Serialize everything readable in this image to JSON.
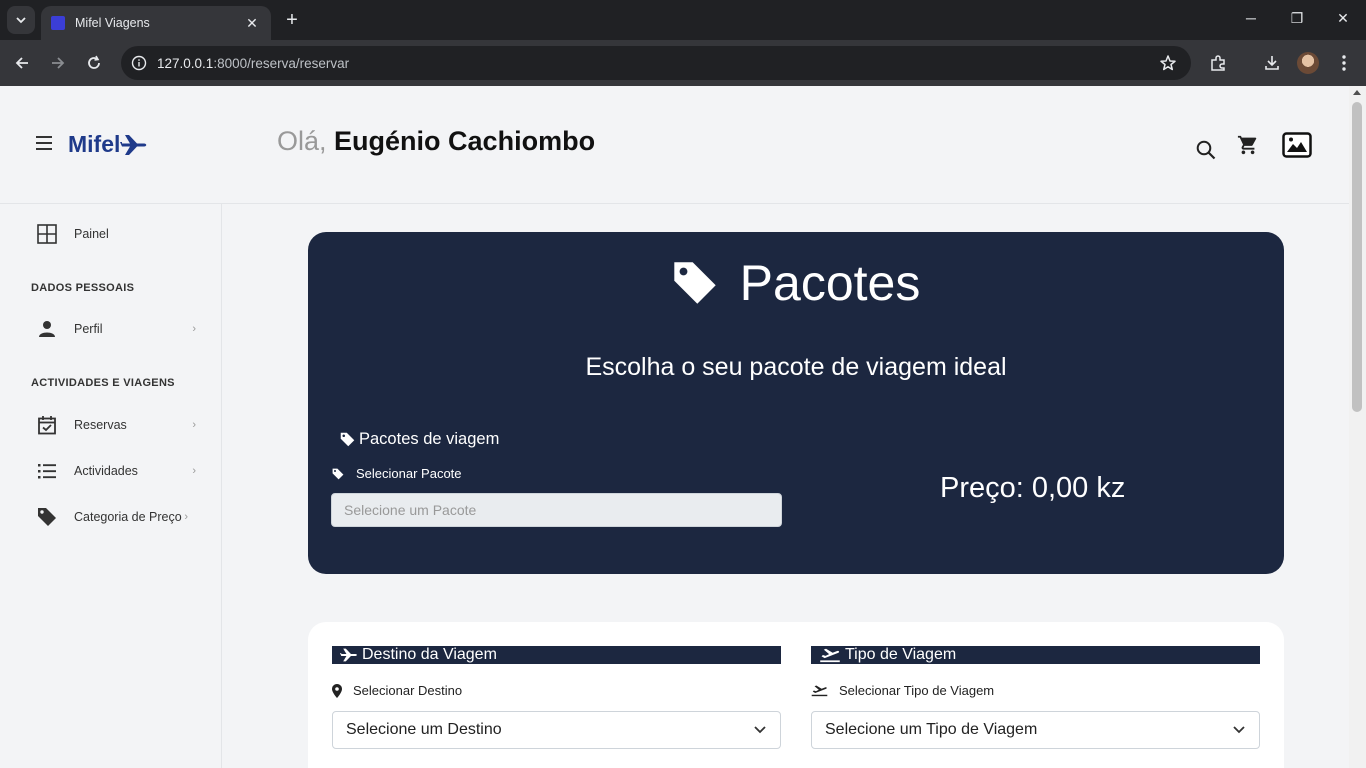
{
  "browser": {
    "tab_title": "Mifel Viagens",
    "tab_close": "✕",
    "new_tab": "+",
    "url_host": "127.0.0.1",
    "url_path": ":8000/reserva/reservar",
    "win_minimize": "─",
    "win_restore": "❐",
    "win_close": "✕"
  },
  "header": {
    "logo_text": "Mifel",
    "greeting_prefix": "Olá,",
    "user_name": "Eugénio Cachiombo"
  },
  "sidebar": {
    "painel": "Painel",
    "section_personal": "DADOS PESSOAIS",
    "perfil": "Perfil",
    "section_activities": "ACTIVIDADES E VIAGENS",
    "reservas": "Reservas",
    "actividades": "Actividades",
    "categoria": "Categoria de Preço",
    "chevron": "›"
  },
  "pacotes": {
    "title": "Pacotes",
    "subtitle": "Escolha o seu pacote de viagem ideal",
    "section_label": "Pacotes de viagem",
    "select_label": "Selecionar Pacote",
    "select_placeholder": "Selecione um Pacote",
    "price": "Preço: 0,00 kz"
  },
  "viagem": {
    "destino_header": "Destino da Viagem",
    "destino_label": "Selecionar Destino",
    "destino_value": "Selecione um Destino",
    "tipo_header": "Tipo de Viagem",
    "tipo_label": "Selecionar Tipo de Viagem",
    "tipo_value": "Selecione um Tipo de Viagem"
  },
  "colors": {
    "card_dark": "#1c2740",
    "logo_blue": "#1f3a8a",
    "page_bg": "#f3f4f6"
  }
}
